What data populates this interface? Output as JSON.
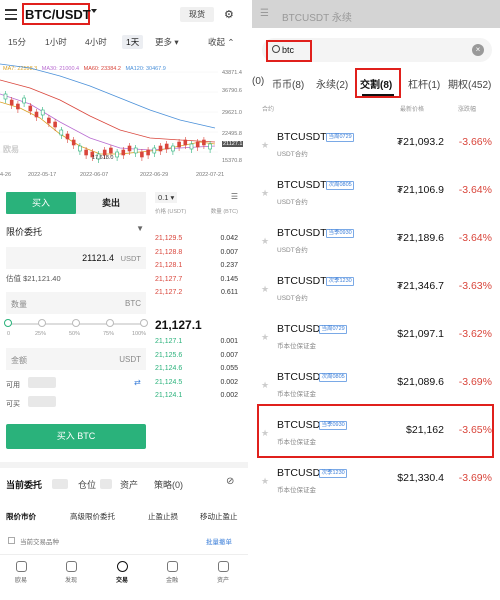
{
  "left": {
    "header": {
      "pair": "BTC/USDT",
      "mode": "现货",
      "icon_name": "settings-icon"
    },
    "timeframes": [
      "15分",
      "1小时",
      "4小时",
      "1天",
      "更多 ▾",
      "收起 ⌃"
    ],
    "active_timeframe_index": 3,
    "ma_labels": [
      {
        "text": "MA7: 22598.3",
        "color": "#d9a125"
      },
      {
        "text": "MA30: 21000.4",
        "color": "#b86bd1"
      },
      {
        "text": "MA60: 23384.2",
        "color": "#d9453b"
      },
      {
        "text": "MA120: 30467.9",
        "color": "#4a90d9"
      }
    ],
    "chart_y_labels": [
      "43871.4",
      "36790.6",
      "29621.0",
      "22495.8",
      "21127.1",
      "15370.8"
    ],
    "chart_x_labels": [
      "4-26",
      "2022-05-17",
      "2022-06-07",
      "2022-06-29",
      "2022-07-21"
    ],
    "chart_low_label": "17,618.0",
    "chart_watermark": "欧易",
    "trade": {
      "buy_tab": "买入",
      "sell_tab": "卖出",
      "order_type": "限价委托",
      "price_value": "21121.4",
      "price_unit": "USDT",
      "estimate": "估值 $21,121.40",
      "qty_placeholder": "数量",
      "qty_unit": "BTC",
      "slider_marks": [
        "0",
        "25%",
        "50%",
        "75%",
        "100%"
      ],
      "amount_placeholder": "金额",
      "amount_unit": "USDT",
      "available_label": "可用",
      "buyable_label": "可买",
      "buy_button": "买入 BTC"
    },
    "orderbook": {
      "depth": "0.1 ▾",
      "col_price": "价格 (USDT)",
      "col_qty": "数量 (BTC)",
      "asks": [
        {
          "price": "21,129.5",
          "qty": "0.042"
        },
        {
          "price": "21,128.8",
          "qty": "0.007"
        },
        {
          "price": "21,128.1",
          "qty": "0.237"
        },
        {
          "price": "21,127.7",
          "qty": "0.145"
        },
        {
          "price": "21,127.2",
          "qty": "0.611"
        }
      ],
      "mid": "21,127.1",
      "bids": [
        {
          "price": "21,127.1",
          "qty": "0.001"
        },
        {
          "price": "21,125.6",
          "qty": "0.007"
        },
        {
          "price": "21,124.6",
          "qty": "0.055"
        },
        {
          "price": "21,124.5",
          "qty": "0.002"
        },
        {
          "price": "21,124.1",
          "qty": "0.002"
        }
      ]
    },
    "orders_tabs": [
      "当前委托",
      "仓位",
      "资产",
      "策略(0)"
    ],
    "orders_sub_tabs": [
      "限价市价",
      "高级限价委托",
      "止盈止损",
      "移动止盈止"
    ],
    "hide_other": "当前交易品种",
    "batch_cancel": "批量撤单",
    "bottom_nav": [
      "欧易",
      "发现",
      "交易",
      "金融",
      "资产"
    ],
    "bottom_nav_active": 2
  },
  "right": {
    "top_text": "BTCUSDT 永续",
    "search_value": "btc",
    "tabs": [
      "(0)",
      "币币(8)",
      "永续(2)",
      "交割(8)",
      "杠杆(1)",
      "期权(452)"
    ],
    "active_tab_index": 3,
    "col_contract": "合约",
    "col_price": "最新价格",
    "col_change": "涨跌幅",
    "rows": [
      {
        "symbol": "BTCUSDT",
        "tag": "当周0729",
        "sub": "USDT合约",
        "price": "₮21,093.2",
        "change": "-3.66%"
      },
      {
        "symbol": "BTCUSDT",
        "tag": "次周0805",
        "sub": "USDT合约",
        "price": "₮21,106.9",
        "change": "-3.64%"
      },
      {
        "symbol": "BTCUSDT",
        "tag": "当季0930",
        "sub": "USDT合约",
        "price": "₮21,189.6",
        "change": "-3.64%"
      },
      {
        "symbol": "BTCUSDT",
        "tag": "次季1230",
        "sub": "USDT合约",
        "price": "₮21,346.7",
        "change": "-3.63%"
      },
      {
        "symbol": "BTCUSD",
        "tag": "当周0729",
        "sub": "币本位保证金",
        "price": "$21,097.1",
        "change": "-3.62%"
      },
      {
        "symbol": "BTCUSD",
        "tag": "次周0805",
        "sub": "币本位保证金",
        "price": "$21,089.6",
        "change": "-3.69%"
      },
      {
        "symbol": "BTCUSD",
        "tag": "当季0930",
        "sub": "币本位保证金",
        "price": "$21,162",
        "change": "-3.65%"
      },
      {
        "symbol": "BTCUSD",
        "tag": "次季1230",
        "sub": "币本位保证金",
        "price": "$21,330.4",
        "change": "-3.69%"
      }
    ],
    "highlight_row_index": 6
  },
  "colors": {
    "green": "#2ab27b",
    "red": "#d9453b",
    "highlight": "#e0201c"
  }
}
